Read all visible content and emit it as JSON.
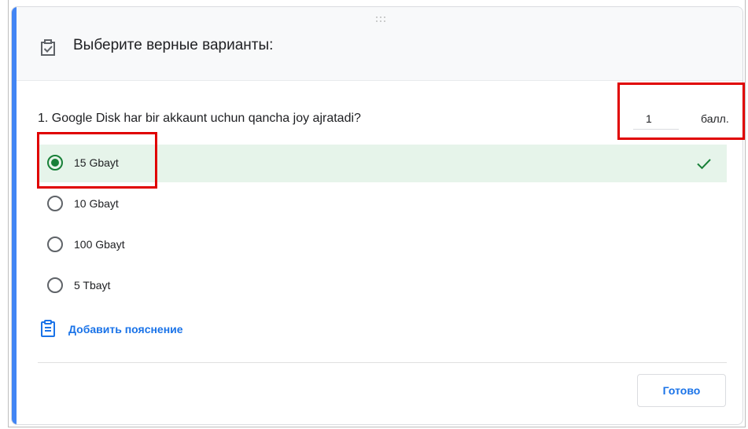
{
  "header": {
    "title": "Выберите верные варианты:",
    "icon": "checkbox-checked-icon"
  },
  "question": {
    "text": "1. Google Disk har bir akkaunt uchun qancha joy ajratadi?",
    "points_value": "1",
    "points_unit": "балл."
  },
  "options": [
    {
      "label": "15 Gbayt",
      "selected": true,
      "correct": true
    },
    {
      "label": "10 Gbayt",
      "selected": false,
      "correct": false
    },
    {
      "label": "100 Gbayt",
      "selected": false,
      "correct": false
    },
    {
      "label": "5 Tbayt",
      "selected": false,
      "correct": false
    }
  ],
  "feedback": {
    "label": "Добавить пояснение",
    "icon": "clipboard-icon"
  },
  "done_button": {
    "label": "Готово"
  },
  "colors": {
    "accent": "#4285f4",
    "correct_bg": "#e6f4ea",
    "correct_mark": "#188038",
    "link": "#1a73e8",
    "highlight": "#e00000"
  }
}
